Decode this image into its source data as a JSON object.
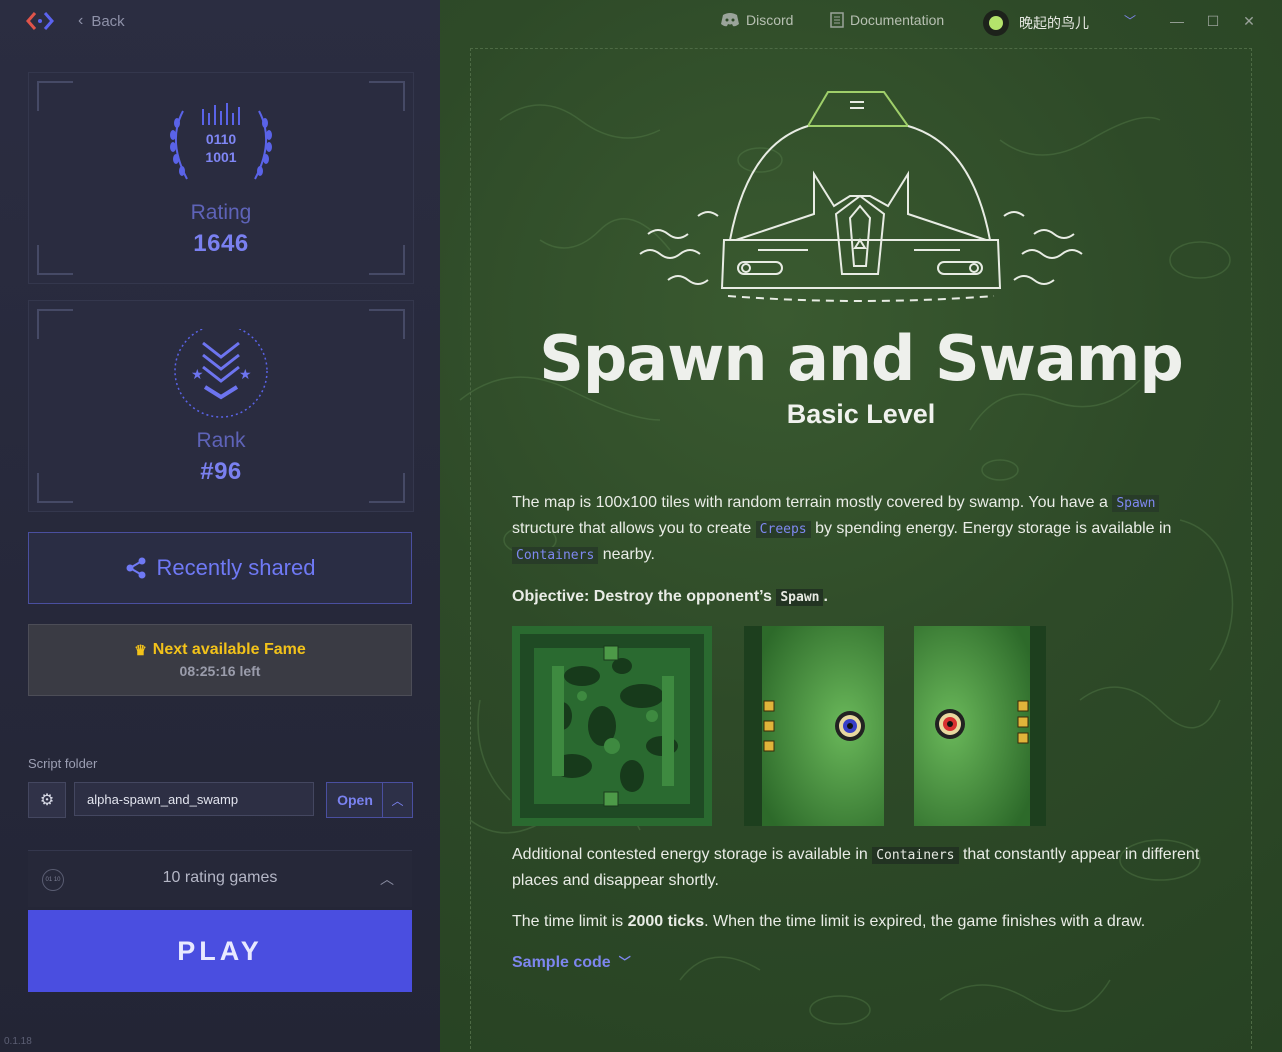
{
  "topbar": {
    "back_label": "Back",
    "discord_label": "Discord",
    "documentation_label": "Documentation",
    "username": "晚起的鸟儿"
  },
  "rating": {
    "label": "Rating",
    "value": "1646",
    "badge_line1": "0110",
    "badge_line2": "1001"
  },
  "rank": {
    "label": "Rank",
    "value": "#96"
  },
  "recently_shared": {
    "label": "Recently shared"
  },
  "fame": {
    "title": "Next available Fame",
    "time_left": "08:25:16 left"
  },
  "script_folder": {
    "label": "Script folder",
    "value": "alpha-spawn_and_swamp",
    "open_label": "Open"
  },
  "games": {
    "label": "10 rating games",
    "icon_text": "01 10"
  },
  "play": {
    "label": "PLAY"
  },
  "version": "0.1.18",
  "level": {
    "title": "Spawn and Swamp",
    "subtitle": "Basic Level",
    "p1_a": "The map is 100x100 tiles with random terrain mostly covered by swamp. You have a ",
    "p1_code1": "Spawn",
    "p1_b": " structure that allows you to create ",
    "p1_code2": "Creeps",
    "p1_c": " by spending energy. Energy storage is available in ",
    "p1_code3": "Containers",
    "p1_d": " nearby.",
    "objective_a": "Objective: Destroy the opponent’s ",
    "objective_code": "Spawn",
    "objective_b": ".",
    "p2_a": "Additional contested energy storage is available in ",
    "p2_code": "Containers",
    "p2_b": " that constantly appear in different places and disappear shortly.",
    "p3_a": "The time limit is ",
    "p3_bold": "2000 ticks",
    "p3_b": ". When the time limit is expired, the game finishes with a draw.",
    "sample_code": "Sample code"
  },
  "colors": {
    "accent": "#4a4ee0",
    "rating_text": "#7a80f0",
    "fame_gold": "#f2c21a",
    "bg_green": "#2e4a28",
    "bg_left": "#2a2c3e"
  }
}
